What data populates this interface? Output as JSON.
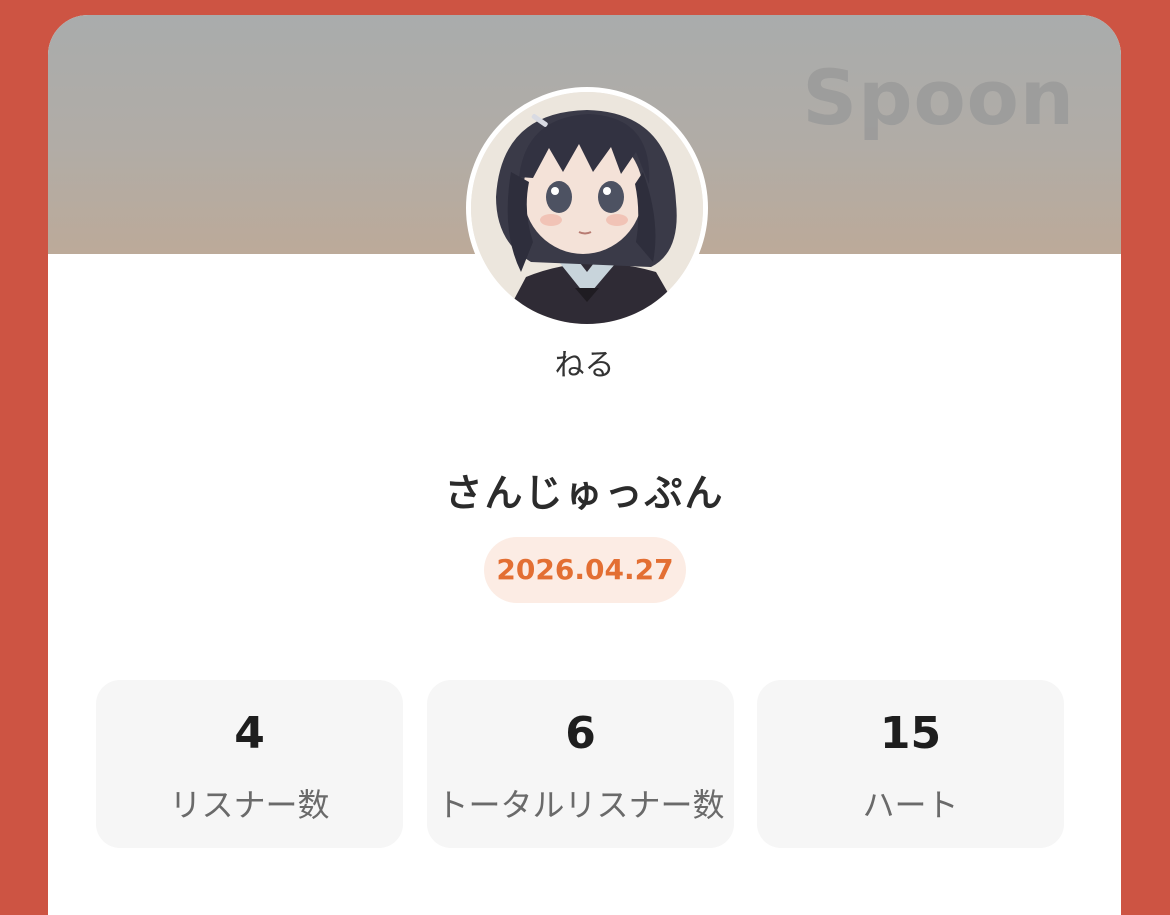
{
  "brand": "Spoon",
  "profile": {
    "username": "ねる"
  },
  "broadcast": {
    "title": "さんじゅっぷん",
    "date": "2026.04.27"
  },
  "stats": [
    {
      "value": "4",
      "label": "リスナー数"
    },
    {
      "value": "6",
      "label": "トータルリスナー数"
    },
    {
      "value": "15",
      "label": "ハート"
    }
  ],
  "colors": {
    "background": "#cd5443",
    "date_text": "#e36f33",
    "date_badge": "#fcece4"
  }
}
